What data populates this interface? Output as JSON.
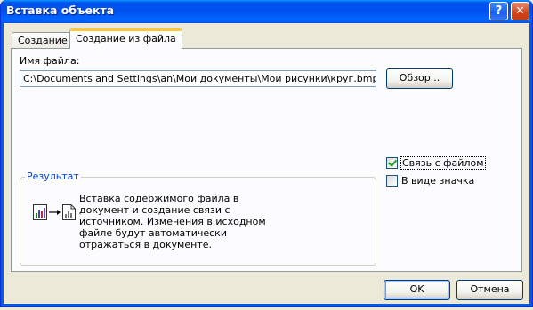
{
  "window": {
    "title": "Вставка объекта",
    "help_glyph": "?",
    "close_glyph": "✕"
  },
  "tabs": [
    {
      "label": "Создание",
      "active": false
    },
    {
      "label": "Создание из файла",
      "active": true
    }
  ],
  "file": {
    "label": "Имя файла:",
    "value": "C:\\Documents and Settings\\an\\Мои документы\\Мои рисунки\\круг.bmp",
    "browse_label": "Обзор..."
  },
  "options": {
    "link_label": "Связь с файлом",
    "link_checked": true,
    "icon_label": "В виде значка",
    "icon_checked": false
  },
  "result": {
    "legend": "Результат",
    "text": "Вставка содержимого файла в документ и создание связи с источником.  Изменения в исходном файле будут автоматически отражаться в документе."
  },
  "buttons": {
    "ok": "OK",
    "cancel": "Отмена"
  },
  "colors": {
    "title_bar": "#0058e6",
    "group_legend": "#0046d5",
    "check_mark": "#21a121"
  }
}
